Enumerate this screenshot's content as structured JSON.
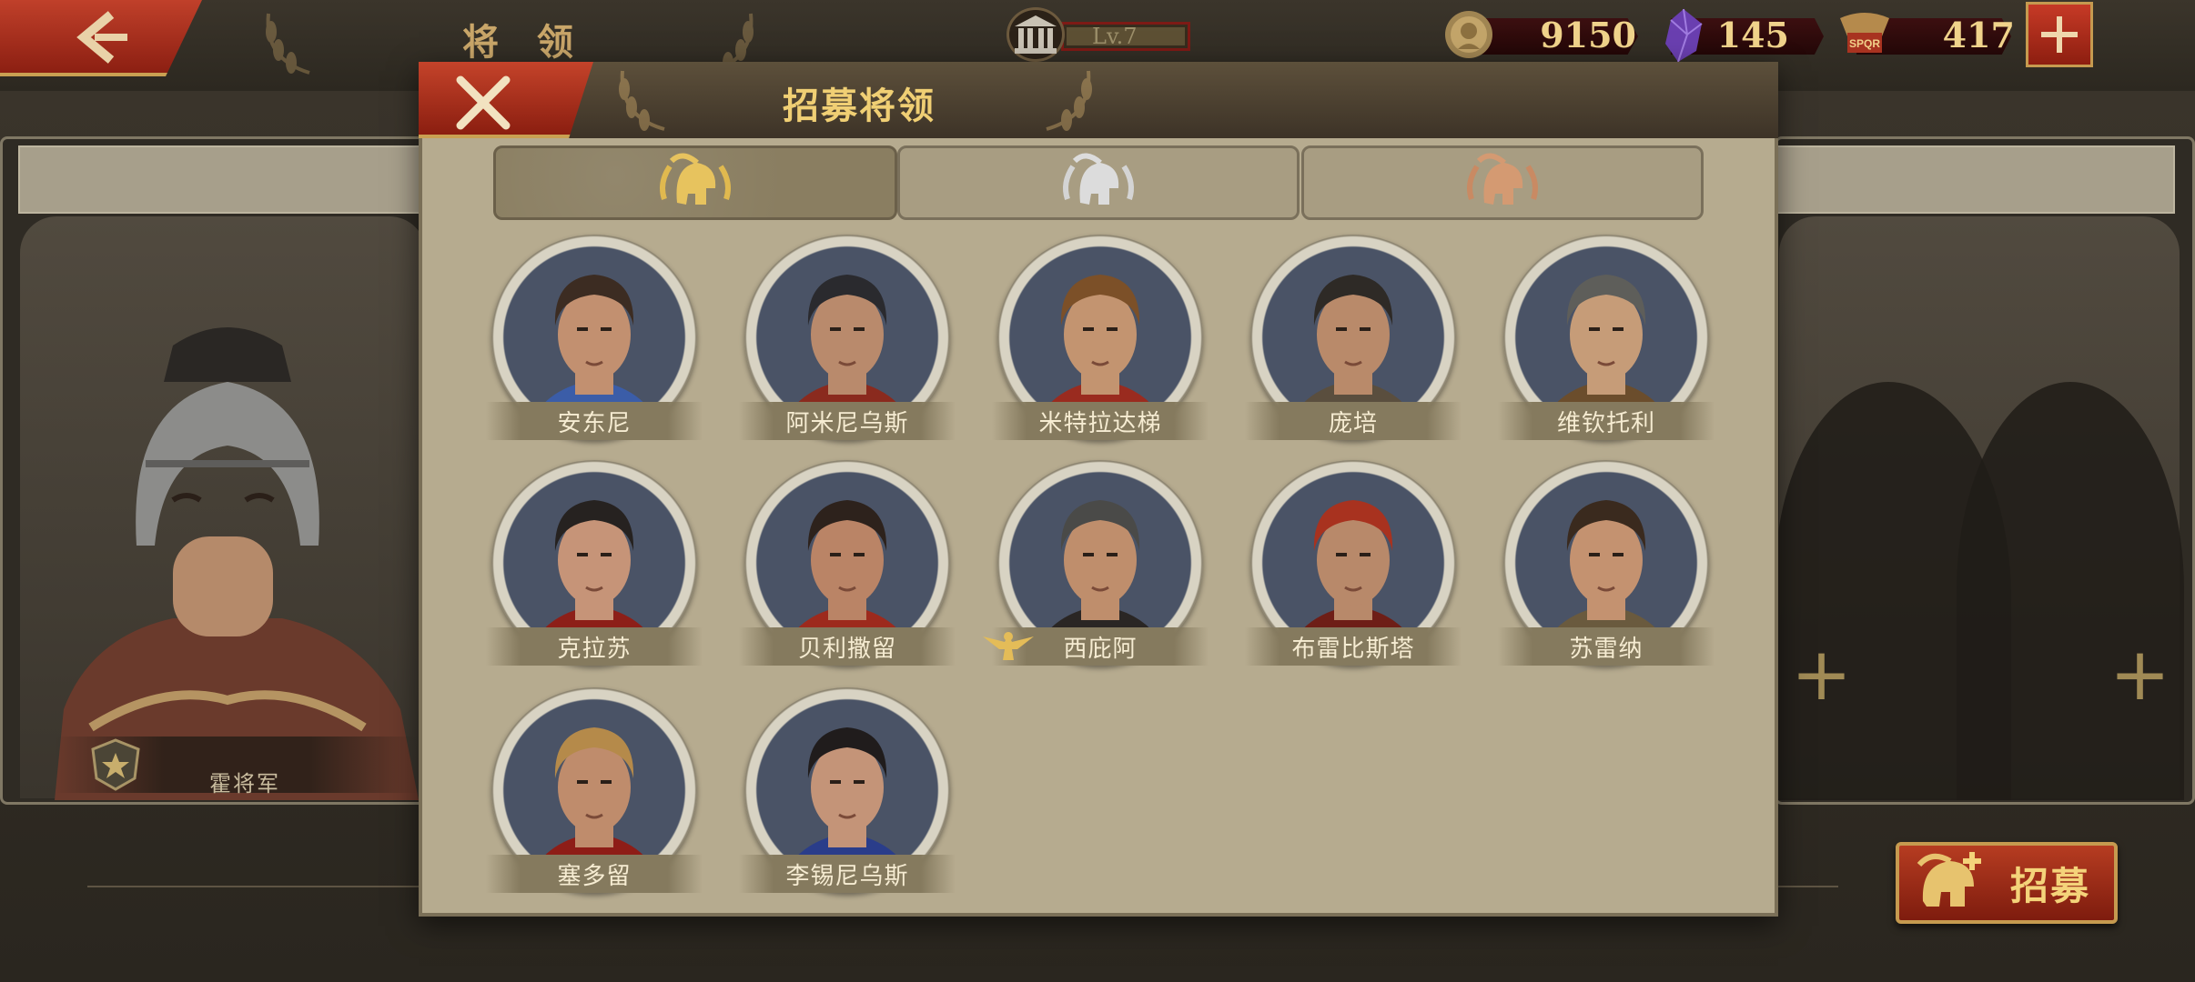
{
  "header": {
    "page_title": "将 领",
    "level": "Lv.7",
    "back_icon": "chevron-left-icon"
  },
  "resources": {
    "gold": "9150",
    "gems": "145",
    "spqr_tokens": "417",
    "spqr_badge_text": "SPQR"
  },
  "dialog": {
    "title": "招募将领",
    "tabs": [
      {
        "icon": "gold-spartan-helmet-icon",
        "tier": "gold",
        "active": true
      },
      {
        "icon": "silver-spartan-helmet-icon",
        "tier": "silver",
        "active": false
      },
      {
        "icon": "bronze-spartan-helmet-icon",
        "tier": "bronze",
        "active": false
      }
    ],
    "generals": [
      {
        "name": "安东尼"
      },
      {
        "name": "阿米尼乌斯"
      },
      {
        "name": "米特拉达梯"
      },
      {
        "name": "庞培"
      },
      {
        "name": "维钦托利"
      },
      {
        "name": "克拉苏"
      },
      {
        "name": "贝利撒留"
      },
      {
        "name": "西庇阿",
        "badge": "eagle-icon"
      },
      {
        "name": "布雷比斯塔"
      },
      {
        "name": "苏雷纳"
      },
      {
        "name": "塞多留"
      },
      {
        "name": "李锡尼乌斯"
      }
    ]
  },
  "side_panel": {
    "general_name": "霍将军",
    "recruit_label": "招募"
  },
  "colors": {
    "accent_red": "#b63c21",
    "gold_text": "#f0cf74",
    "parchment": "#b6ab8f"
  }
}
